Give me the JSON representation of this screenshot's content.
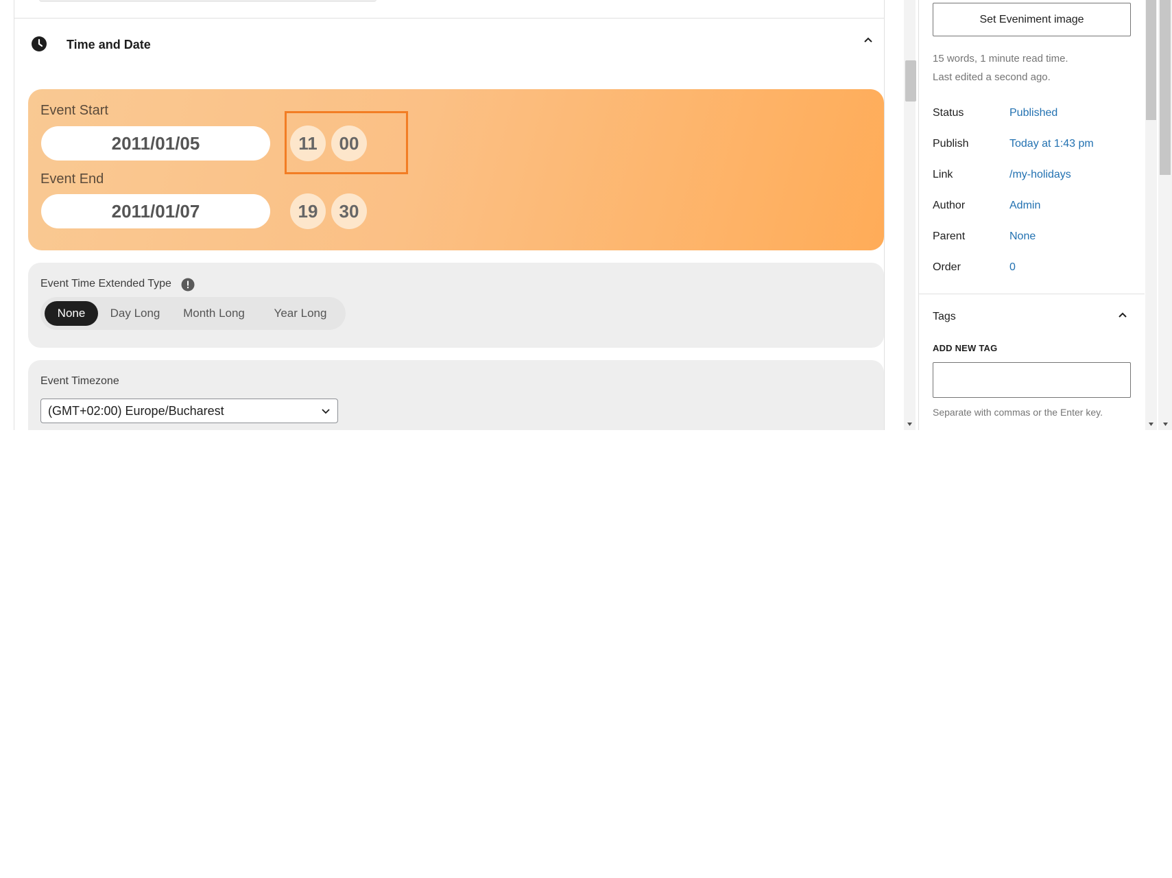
{
  "section": {
    "title": "Time and Date",
    "icon": "clock-icon",
    "collapse_icon": "chevron-up-icon"
  },
  "event_start": {
    "label": "Event Start",
    "date": "2011/01/05",
    "hour": "11",
    "minute": "00"
  },
  "event_end": {
    "label": "Event End",
    "date": "2011/01/07",
    "hour": "19",
    "minute": "30"
  },
  "extended_type": {
    "label": "Event Time Extended Type",
    "info_icon": "info-icon",
    "options": [
      "None",
      "Day Long",
      "Month Long",
      "Year Long"
    ],
    "selected": "None"
  },
  "timezone": {
    "label": "Event Timezone",
    "value": "(GMT+02:00) Europe/Bucharest"
  },
  "sidebar": {
    "set_image_label": "Set Eveniment image",
    "word_count": "15 words, 1 minute read time.",
    "last_edited": "Last edited a second ago.",
    "rows": [
      {
        "label": "Status",
        "value": "Published"
      },
      {
        "label": "Publish",
        "value": "Today at 1:43 pm"
      },
      {
        "label": "Link",
        "value": "/my-holidays"
      },
      {
        "label": "Author",
        "value": "Admin"
      },
      {
        "label": "Parent",
        "value": "None"
      },
      {
        "label": "Order",
        "value": "0"
      }
    ],
    "tags": {
      "title": "Tags",
      "add_label": "ADD NEW TAG",
      "input_value": "",
      "help": "Separate with commas or the Enter key."
    }
  },
  "colors": {
    "card_gradient_start": "#f9c993",
    "card_gradient_end": "#ffac58",
    "highlight": "#f27d24",
    "link": "#2271b1",
    "active_segment": "#1f1f1f"
  }
}
